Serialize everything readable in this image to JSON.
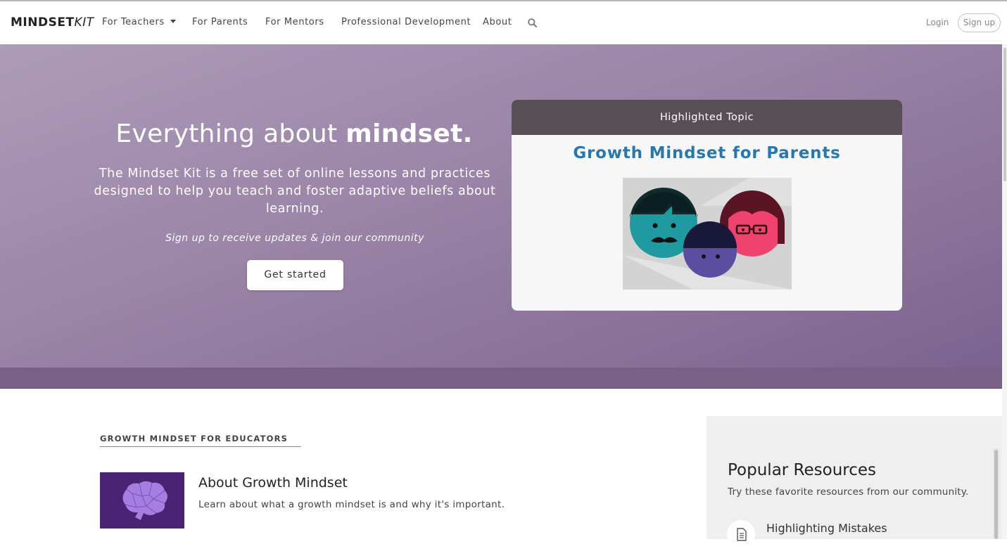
{
  "nav": {
    "logo_main": "MINDSET",
    "logo_accent": "KIT",
    "items": [
      {
        "label": "For Teachers",
        "has_dropdown": true
      },
      {
        "label": "For Parents"
      },
      {
        "label": "For Mentors"
      },
      {
        "label": "Professional Development"
      },
      {
        "label": "About"
      }
    ],
    "login_label": "Login",
    "signup_label": "Sign up"
  },
  "hero": {
    "title_prefix": "Everything about ",
    "title_bold": "mindset.",
    "description": "The Mindset Kit is a free set of online lessons and practices designed to help you teach and foster adaptive beliefs about learning.",
    "subtext": "Sign up to receive updates & join our community",
    "cta_label": "Get started"
  },
  "highlight": {
    "header": "Highlighted Topic",
    "title": "Growth Mindset for Parents"
  },
  "educators": {
    "section_label": "GROWTH MINDSET FOR EDUCATORS",
    "items": [
      {
        "title": "About Growth Mindset",
        "description": "Learn about what a growth mindset is and why it's important."
      }
    ]
  },
  "popular": {
    "title": "Popular Resources",
    "description": "Try these favorite resources from our community.",
    "items": [
      {
        "title": "Highlighting Mistakes",
        "icon": "document-icon"
      }
    ]
  },
  "colors": {
    "hero_purple": "#9c86a9",
    "card_header": "#574f55",
    "card_title_blue": "#2a77ac",
    "brain_bg": "#4c2374"
  }
}
